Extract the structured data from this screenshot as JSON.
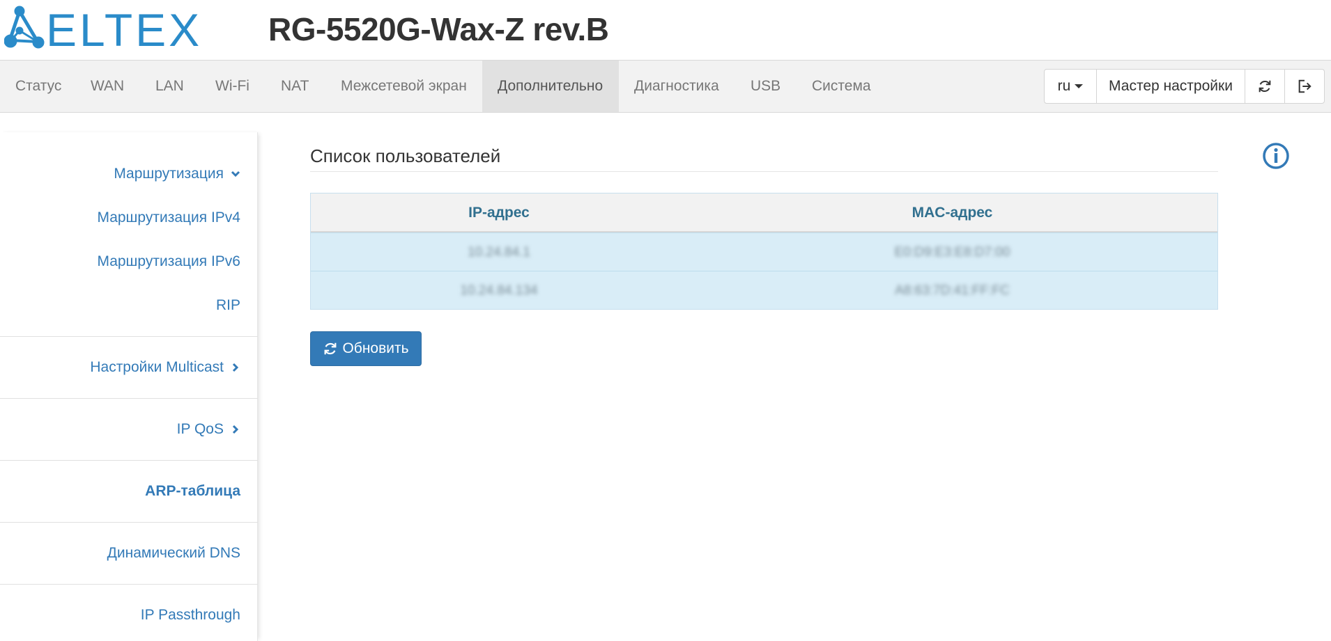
{
  "brand": {
    "logo_text": "ELTEX",
    "logo_color": "#2a8bc9"
  },
  "device": {
    "title": "RG-5520G-Wax-Z rev.B"
  },
  "nav": {
    "items": [
      {
        "label": "Статус"
      },
      {
        "label": "WAN"
      },
      {
        "label": "LAN"
      },
      {
        "label": "Wi-Fi"
      },
      {
        "label": "NAT"
      },
      {
        "label": "Межсетевой экран"
      },
      {
        "label": "Дополнительно",
        "active": true
      },
      {
        "label": "Диагностика"
      },
      {
        "label": "USB"
      },
      {
        "label": "Система"
      }
    ],
    "language": "ru",
    "wizard_label": "Мастер настройки",
    "refresh_icon": "refresh-icon",
    "logout_icon": "logout-icon"
  },
  "sidebar": {
    "items": [
      {
        "label": "Маршрутизация",
        "icon": "chevron-down-icon"
      },
      {
        "label": "Маршрутизация IPv4"
      },
      {
        "label": "Маршрутизация IPv6"
      },
      {
        "label": "RIP"
      },
      {
        "label": "Настройки Multicast",
        "icon": "chevron-right-icon"
      },
      {
        "label": "IP QoS",
        "icon": "chevron-right-icon"
      },
      {
        "label": "ARP-таблица",
        "active": true
      },
      {
        "label": "Динамический DNS"
      },
      {
        "label": "IP Passthrough"
      }
    ]
  },
  "main": {
    "title": "Список пользователей",
    "info_icon": "info-icon",
    "table": {
      "headers": [
        "IP-адрес",
        "MAC-адрес"
      ],
      "rows": [
        [
          "10.24.84.1",
          "E0:D9:E3:E8:D7:00"
        ],
        [
          "10.24.84.134",
          "A8:63:7D:41:FF:FC"
        ]
      ]
    },
    "refresh_button": "Обновить"
  },
  "colors": {
    "accent": "#337ab7",
    "header_text": "#31708f",
    "row_bg": "#d9edf7",
    "navbar_bg": "#f2f2f2"
  }
}
